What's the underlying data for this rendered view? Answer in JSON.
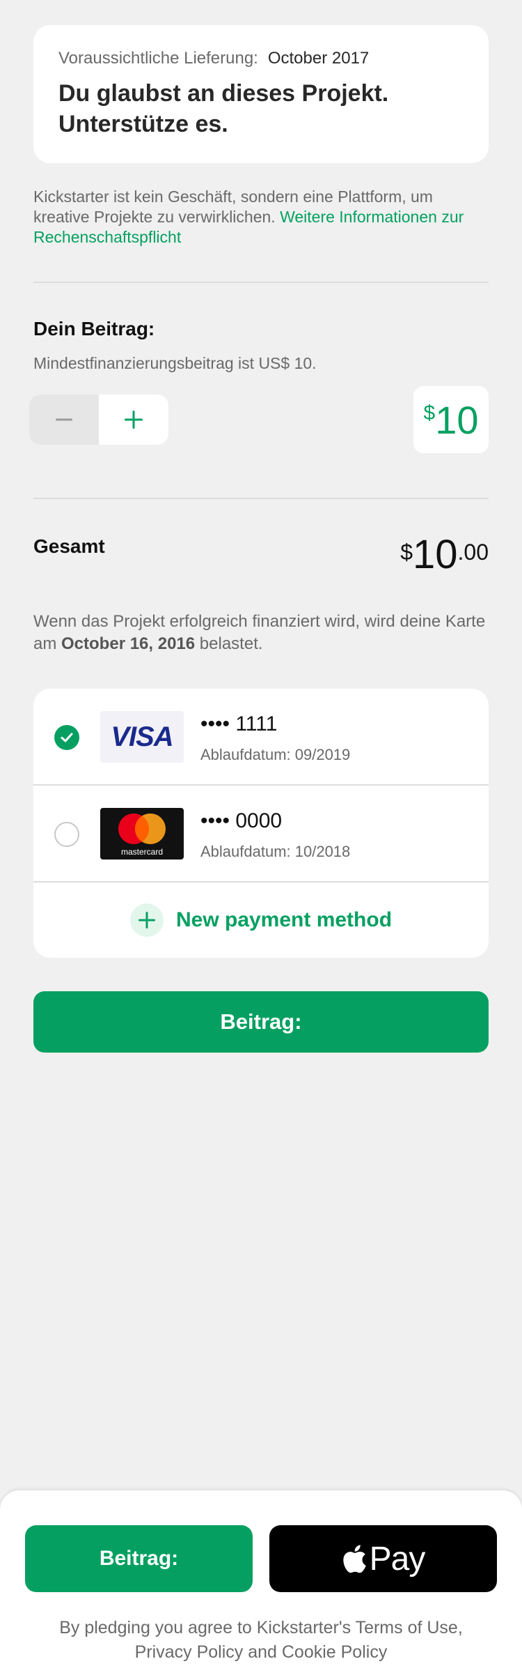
{
  "reward": {
    "delivery_label": "Voraussichtliche Lieferung:",
    "delivery_date": "October 2017",
    "title_line1": "Du glaubst an dieses Projekt.",
    "title_line2": "Unterstütze es."
  },
  "info": {
    "text": "Kickstarter ist kein Geschäft, sondern eine Plattform, um kreative Projekte zu verwirklichen.",
    "link": "Weitere Informationen zur Rechenschaftspflicht"
  },
  "pledge": {
    "label": "Dein Beitrag:",
    "minimum": "Mindestfinanzierungsbeitrag ist US$ 10.",
    "currency": "$",
    "amount": "10"
  },
  "total": {
    "label": "Gesamt",
    "currency": "$",
    "integer": "10",
    "cents": ".00"
  },
  "charge": {
    "prefix": "Wenn das Projekt erfolgreich finanziert wird, wird deine Karte am",
    "date": "October 16, 2016",
    "suffix": "belastet."
  },
  "payment_methods": [
    {
      "brand": "VISA",
      "number": "•••• 1111",
      "expiry": "Ablaufdatum: 09/2019",
      "selected": true
    },
    {
      "brand": "mastercard",
      "number": "•••• 0000",
      "expiry": "Ablaufdatum: 10/2018",
      "selected": false
    }
  ],
  "new_payment_method": "New payment method",
  "pledge_button": "Beitrag:",
  "bottom": {
    "pledge_button": "Beitrag:",
    "apple_pay_label": "Pay",
    "terms": "By pledging you agree to Kickstarter's Terms of Use, Privacy Policy and Cookie Policy"
  },
  "colors": {
    "accent": "#05a061",
    "background": "#f0f0f0"
  }
}
